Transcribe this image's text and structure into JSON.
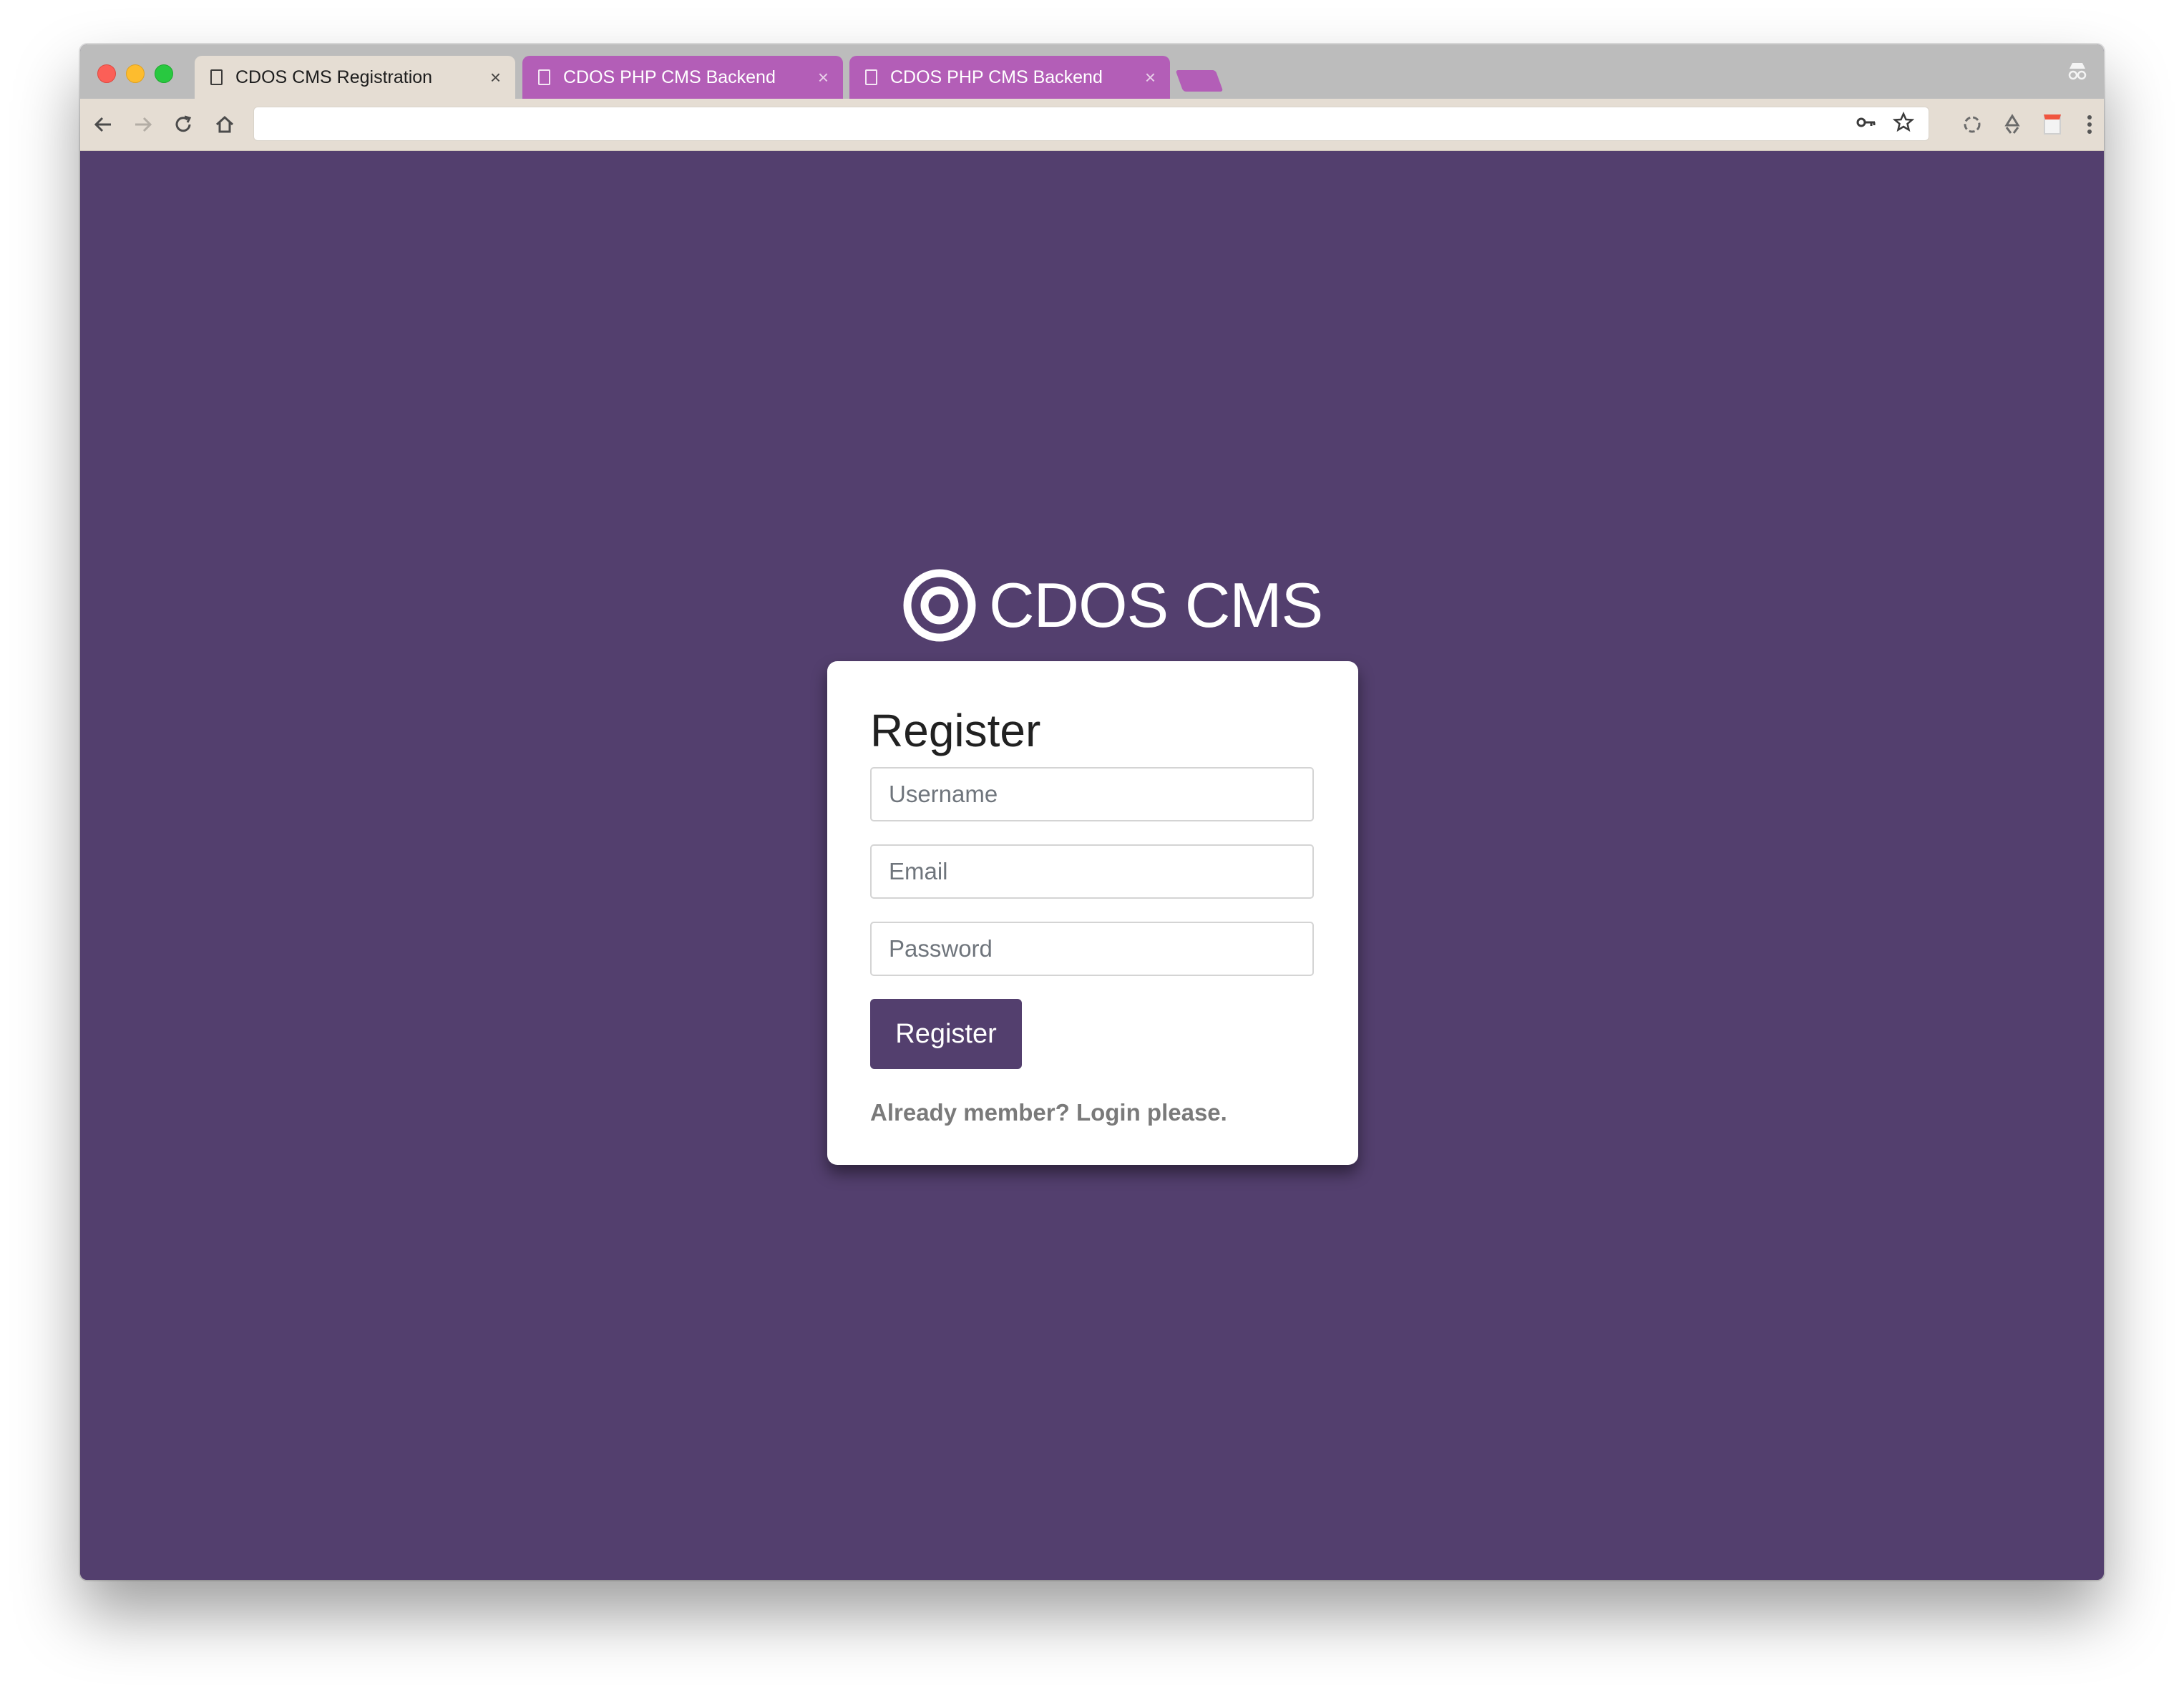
{
  "browser": {
    "tabs": [
      {
        "title": "CDOS CMS Registration",
        "active": true
      },
      {
        "title": "CDOS PHP CMS Backend",
        "active": false
      },
      {
        "title": "CDOS PHP CMS Backend",
        "active": false
      }
    ],
    "tab_close_glyph": "×",
    "address": "",
    "colors": {
      "tab_accent": "#b35eb7",
      "toolbar": "#e5ddd3"
    }
  },
  "brand": {
    "name": "CDOS CMS",
    "logo_icon": "target-icon"
  },
  "form": {
    "title": "Register",
    "username_placeholder": "Username",
    "email_placeholder": "Email",
    "password_placeholder": "Password",
    "submit_label": "Register",
    "login_link": "Already member? Login please."
  },
  "colors": {
    "page_background": "#533f6e",
    "button_background": "#533f6e",
    "card_background": "#ffffff"
  }
}
